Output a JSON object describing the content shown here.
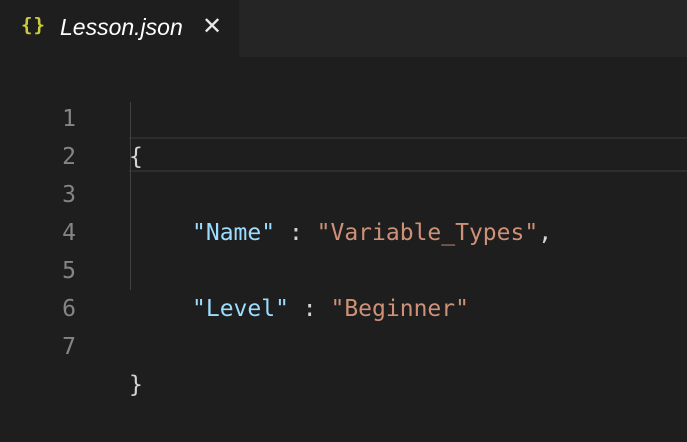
{
  "tab": {
    "icon": "{}",
    "icon_name": "json-braces-icon",
    "title": "Lesson.json",
    "close_glyph": "✕"
  },
  "editor": {
    "lines": [
      {
        "number": "1",
        "text": "{"
      },
      {
        "number": "2",
        "text": ""
      },
      {
        "number": "3",
        "key": "\"Name\"",
        "sep": " : ",
        "value": "\"Variable_Types\"",
        "trail": ","
      },
      {
        "number": "4",
        "text": ""
      },
      {
        "number": "5",
        "key": "\"Level\"",
        "sep": " : ",
        "value": "\"Beginner\"",
        "trail": ""
      },
      {
        "number": "6",
        "text": ""
      },
      {
        "number": "7",
        "text": "}"
      }
    ]
  },
  "colors": {
    "editor_background": "#1e1e1e",
    "tabbar_background": "#252526",
    "json_key": "#9cdcfe",
    "json_string": "#ce9178",
    "line_number": "#858585",
    "icon_yellow": "#cbcb41"
  }
}
